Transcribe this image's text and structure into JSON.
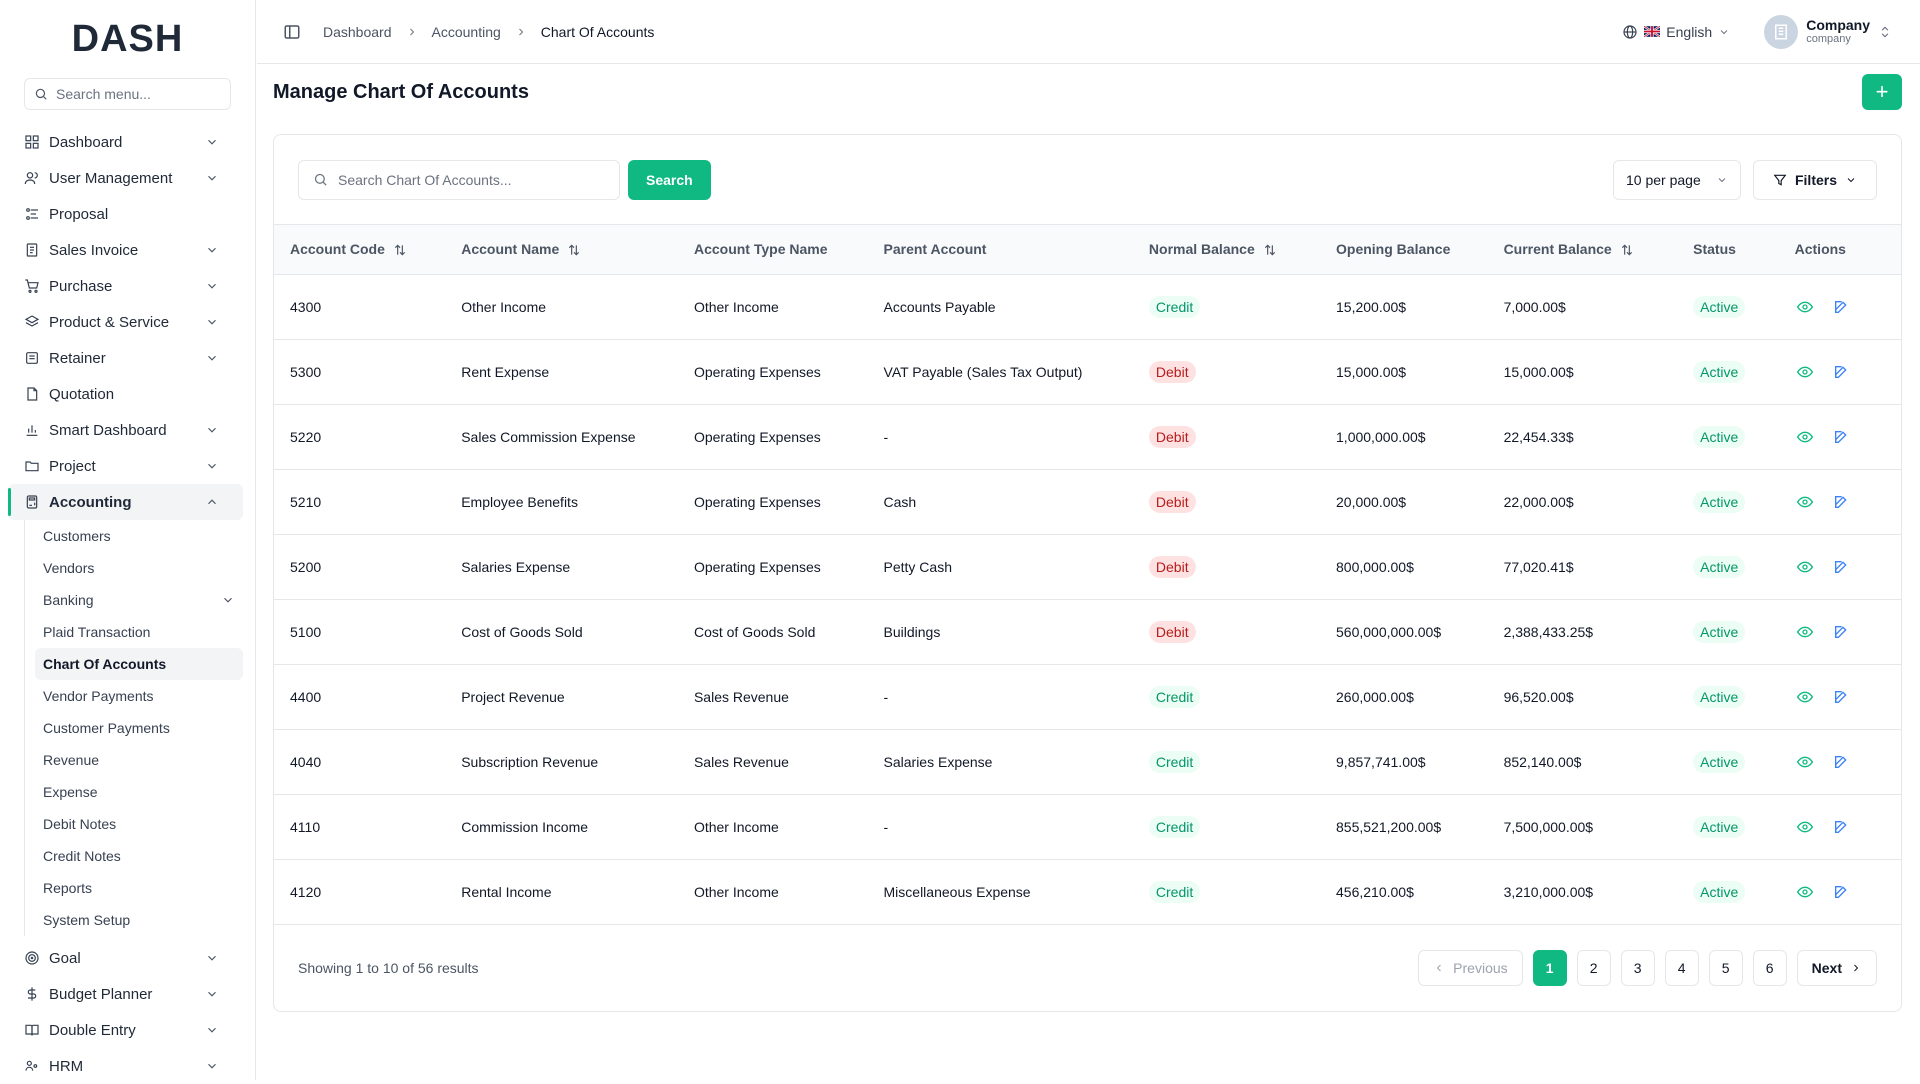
{
  "brand": {
    "logo": "DASH"
  },
  "sidebar": {
    "search_placeholder": "Search menu...",
    "items": [
      {
        "label": "Dashboard",
        "icon": "grid-icon",
        "chevron": true
      },
      {
        "label": "User Management",
        "icon": "users-icon",
        "chevron": true
      },
      {
        "label": "Proposal",
        "icon": "proposal-icon",
        "chevron": false
      },
      {
        "label": "Sales Invoice",
        "icon": "invoice-icon",
        "chevron": true
      },
      {
        "label": "Purchase",
        "icon": "cart-icon",
        "chevron": true
      },
      {
        "label": "Product & Service",
        "icon": "layers-icon",
        "chevron": true
      },
      {
        "label": "Retainer",
        "icon": "retainer-icon",
        "chevron": true
      },
      {
        "label": "Quotation",
        "icon": "file-icon",
        "chevron": false
      },
      {
        "label": "Smart Dashboard",
        "icon": "chart-icon",
        "chevron": true
      },
      {
        "label": "Project",
        "icon": "folder-icon",
        "chevron": true
      },
      {
        "label": "Accounting",
        "icon": "calculator-icon",
        "chevron": true
      }
    ],
    "accounting_sub": [
      {
        "label": "Customers"
      },
      {
        "label": "Vendors"
      },
      {
        "label": "Banking"
      },
      {
        "label": "Plaid Transaction"
      },
      {
        "label": "Chart Of Accounts"
      },
      {
        "label": "Vendor Payments"
      },
      {
        "label": "Customer Payments"
      },
      {
        "label": "Revenue"
      },
      {
        "label": "Expense"
      },
      {
        "label": "Debit Notes"
      },
      {
        "label": "Credit Notes"
      },
      {
        "label": "Reports"
      },
      {
        "label": "System Setup"
      }
    ],
    "bottom_items": [
      {
        "label": "Goal",
        "icon": "target-icon"
      },
      {
        "label": "Budget Planner",
        "icon": "dollar-icon"
      },
      {
        "label": "Double Entry",
        "icon": "book-icon"
      },
      {
        "label": "HRM",
        "icon": "hrm-icon"
      }
    ]
  },
  "header": {
    "breadcrumbs": [
      "Dashboard",
      "Accounting",
      "Chart Of Accounts"
    ],
    "language": "English",
    "user_name": "Company",
    "user_role": "company"
  },
  "page": {
    "title": "Manage Chart Of Accounts",
    "add_label": "+",
    "search_placeholder": "Search Chart Of Accounts...",
    "search_button": "Search",
    "per_page": "10 per page",
    "filters": "Filters"
  },
  "table": {
    "columns": [
      "Account Code",
      "Account Name",
      "Account Type Name",
      "Parent Account",
      "Normal Balance",
      "Opening Balance",
      "Current Balance",
      "Status",
      "Actions"
    ],
    "rows": [
      {
        "code": "4300",
        "name": "Other Income",
        "type": "Other Income",
        "parent": "Accounts Payable",
        "normal": "Credit",
        "opening": "15,200.00$",
        "current": "7,000.00$",
        "status": "Active"
      },
      {
        "code": "5300",
        "name": "Rent Expense",
        "type": "Operating Expenses",
        "parent": "VAT Payable (Sales Tax Output)",
        "normal": "Debit",
        "opening": "15,000.00$",
        "current": "15,000.00$",
        "status": "Active"
      },
      {
        "code": "5220",
        "name": "Sales Commission Expense",
        "type": "Operating Expenses",
        "parent": "-",
        "normal": "Debit",
        "opening": "1,000,000.00$",
        "current": "22,454.33$",
        "status": "Active"
      },
      {
        "code": "5210",
        "name": "Employee Benefits",
        "type": "Operating Expenses",
        "parent": "Cash",
        "normal": "Debit",
        "opening": "20,000.00$",
        "current": "22,000.00$",
        "status": "Active"
      },
      {
        "code": "5200",
        "name": "Salaries Expense",
        "type": "Operating Expenses",
        "parent": "Petty Cash",
        "normal": "Debit",
        "opening": "800,000.00$",
        "current": "77,020.41$",
        "status": "Active"
      },
      {
        "code": "5100",
        "name": "Cost of Goods Sold",
        "type": "Cost of Goods Sold",
        "parent": "Buildings",
        "normal": "Debit",
        "opening": "560,000,000.00$",
        "current": "2,388,433.25$",
        "status": "Active"
      },
      {
        "code": "4400",
        "name": "Project Revenue",
        "type": "Sales Revenue",
        "parent": "-",
        "normal": "Credit",
        "opening": "260,000.00$",
        "current": "96,520.00$",
        "status": "Active"
      },
      {
        "code": "4040",
        "name": "Subscription Revenue",
        "type": "Sales Revenue",
        "parent": "Salaries Expense",
        "normal": "Credit",
        "opening": "9,857,741.00$",
        "current": "852,140.00$",
        "status": "Active"
      },
      {
        "code": "4110",
        "name": "Commission Income",
        "type": "Other Income",
        "parent": "-",
        "normal": "Credit",
        "opening": "855,521,200.00$",
        "current": "7,500,000.00$",
        "status": "Active"
      },
      {
        "code": "4120",
        "name": "Rental Income",
        "type": "Other Income",
        "parent": "Miscellaneous Expense",
        "normal": "Credit",
        "opening": "456,210.00$",
        "current": "3,210,000.00$",
        "status": "Active"
      }
    ]
  },
  "pagination": {
    "showing": "Showing 1 to 10 of 56 results",
    "previous": "Previous",
    "next": "Next",
    "pages": [
      "1",
      "2",
      "3",
      "4",
      "5",
      "6"
    ],
    "current": "1"
  },
  "colors": {
    "accent": "#10b981",
    "credit_bg": "#ecfdf5",
    "debit_bg": "#fee2e2",
    "action_green": "#10b981",
    "action_blue": "#3b82f6"
  }
}
